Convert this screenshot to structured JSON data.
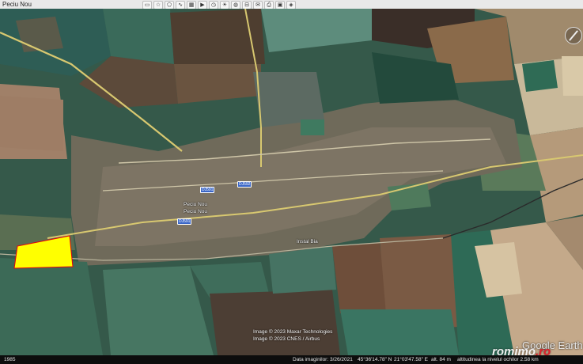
{
  "window": {
    "title": "Peciu Nou"
  },
  "toolbar": {
    "icons": [
      "folder-icon",
      "star-icon",
      "polygon-icon",
      "path-icon",
      "overlay-icon",
      "tour-icon",
      "clock-icon",
      "sun-icon",
      "planet-icon",
      "ruler-icon",
      "email-icon",
      "print-icon",
      "save-image-icon",
      "maps-icon"
    ]
  },
  "map": {
    "places": {
      "town": "Peciu Nou",
      "landmarks": [
        "Instal Bia",
        "Peciu Nou"
      ]
    },
    "roads": [
      "DJ591",
      "DJ592",
      "DJ591"
    ],
    "attribution": {
      "line1": "Image © 2023 Maxar Technologies",
      "line2": "Image © 2023 CNES / Airbus"
    },
    "google_logo": "Google Earth",
    "watermark_prefix": "romimo",
    "watermark_suffix": ".ro",
    "plot_highlight_color": "#ffff00"
  },
  "statusbar": {
    "scale": "1985",
    "imagery_date": "Data imaginilor: 3/26/2021",
    "latitude": "45°36'14.78\" N",
    "longitude": "21°03'47.58\" E",
    "elevation": "alt.  84 m",
    "eye_alt": "altitudinea la nivelul ochilor   2.58 km"
  }
}
